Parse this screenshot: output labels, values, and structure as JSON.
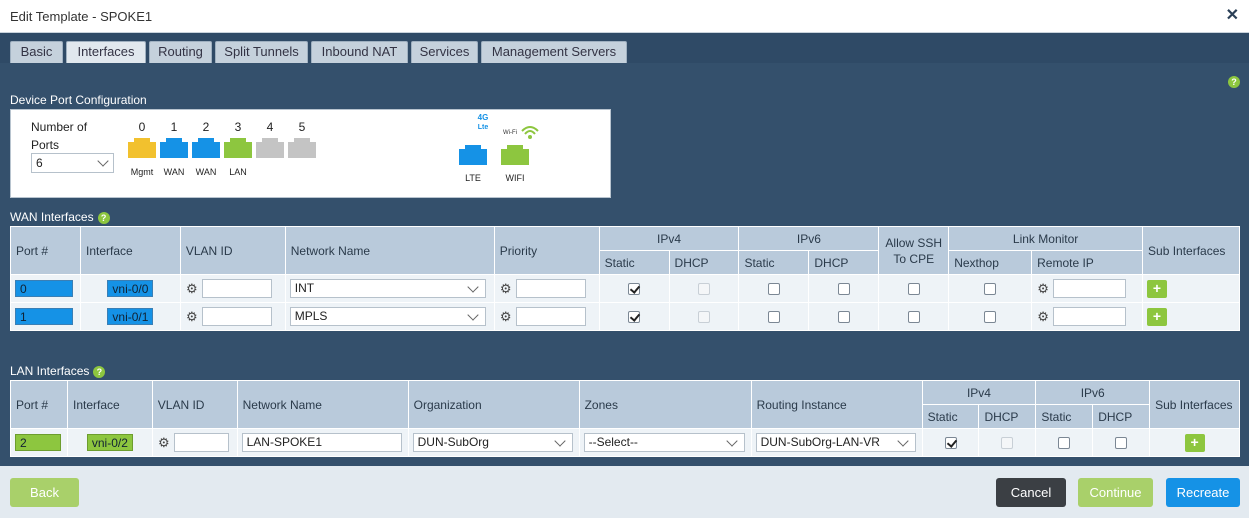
{
  "window": {
    "title": "Edit Template - SPOKE1",
    "close_label": "✕"
  },
  "tabs": [
    {
      "label": "Basic"
    },
    {
      "label": "Interfaces"
    },
    {
      "label": "Routing"
    },
    {
      "label": "Split Tunnels"
    },
    {
      "label": "Inbound NAT"
    },
    {
      "label": "Services"
    },
    {
      "label": "Management Servers"
    }
  ],
  "active_tab": "Interfaces",
  "help_glyph": "?",
  "device_port": {
    "section_label": "Device Port Configuration",
    "number_of_ports_label": "Number of Ports",
    "number_of_ports_value": "6",
    "ports": [
      {
        "num": "0",
        "label": "Mgmt",
        "color": "#f2c12e"
      },
      {
        "num": "1",
        "label": "WAN",
        "color": "#1592e6"
      },
      {
        "num": "2",
        "label": "WAN",
        "color": "#1592e6"
      },
      {
        "num": "3",
        "label": "LAN",
        "color": "#8dc63f"
      },
      {
        "num": "4",
        "label": "",
        "color": "#c4c4c4"
      },
      {
        "num": "5",
        "label": "",
        "color": "#c4c4c4"
      }
    ],
    "lte": {
      "badge_top": "4G",
      "badge_bottom": "Lte",
      "label": "LTE",
      "color": "#1592e6"
    },
    "wifi": {
      "label": "WIFI",
      "badge": "Wi-Fi",
      "color": "#8dc63f"
    }
  },
  "wan": {
    "section_label": "WAN Interfaces",
    "headers": {
      "port": "Port #",
      "interface": "Interface",
      "vlan": "VLAN ID",
      "network": "Network Name",
      "priority": "Priority",
      "ipv4": "IPv4",
      "ipv6": "IPv6",
      "static": "Static",
      "dhcp": "DHCP",
      "allow_ssh": "Allow SSH To CPE",
      "link_monitor": "Link Monitor",
      "nexthop": "Nexthop",
      "remote_ip": "Remote IP",
      "sub_interfaces": "Sub Interfaces"
    },
    "rows": [
      {
        "port": "0",
        "interface": "vni-0/0",
        "vlan": "",
        "network": "INT",
        "priority": "",
        "ipv4_static": true,
        "ipv4_dhcp": false,
        "ipv6_static": false,
        "ipv6_dhcp": false,
        "allow_ssh": false,
        "nexthop": false,
        "remote_ip": ""
      },
      {
        "port": "1",
        "interface": "vni-0/1",
        "vlan": "",
        "network": "MPLS",
        "priority": "",
        "ipv4_static": true,
        "ipv4_dhcp": false,
        "ipv6_static": false,
        "ipv6_dhcp": false,
        "allow_ssh": false,
        "nexthop": false,
        "remote_ip": ""
      }
    ]
  },
  "lan": {
    "section_label": "LAN Interfaces",
    "headers": {
      "port": "Port #",
      "interface": "Interface",
      "vlan": "VLAN ID",
      "network": "Network Name",
      "organization": "Organization",
      "zones": "Zones",
      "routing_instance": "Routing Instance",
      "ipv4": "IPv4",
      "ipv6": "IPv6",
      "static": "Static",
      "dhcp": "DHCP",
      "sub_interfaces": "Sub Interfaces"
    },
    "rows": [
      {
        "port": "2",
        "interface": "vni-0/2",
        "vlan": "",
        "network": "LAN-SPOKE1",
        "organization": "DUN-SubOrg",
        "zones": "--Select--",
        "routing_instance": "DUN-SubOrg-LAN-VR",
        "ipv4_static": true,
        "ipv4_dhcp": false,
        "ipv6_static": false,
        "ipv6_dhcp": false
      }
    ]
  },
  "footer": {
    "back": "Back",
    "cancel": "Cancel",
    "continue": "Continue",
    "recreate": "Recreate"
  }
}
